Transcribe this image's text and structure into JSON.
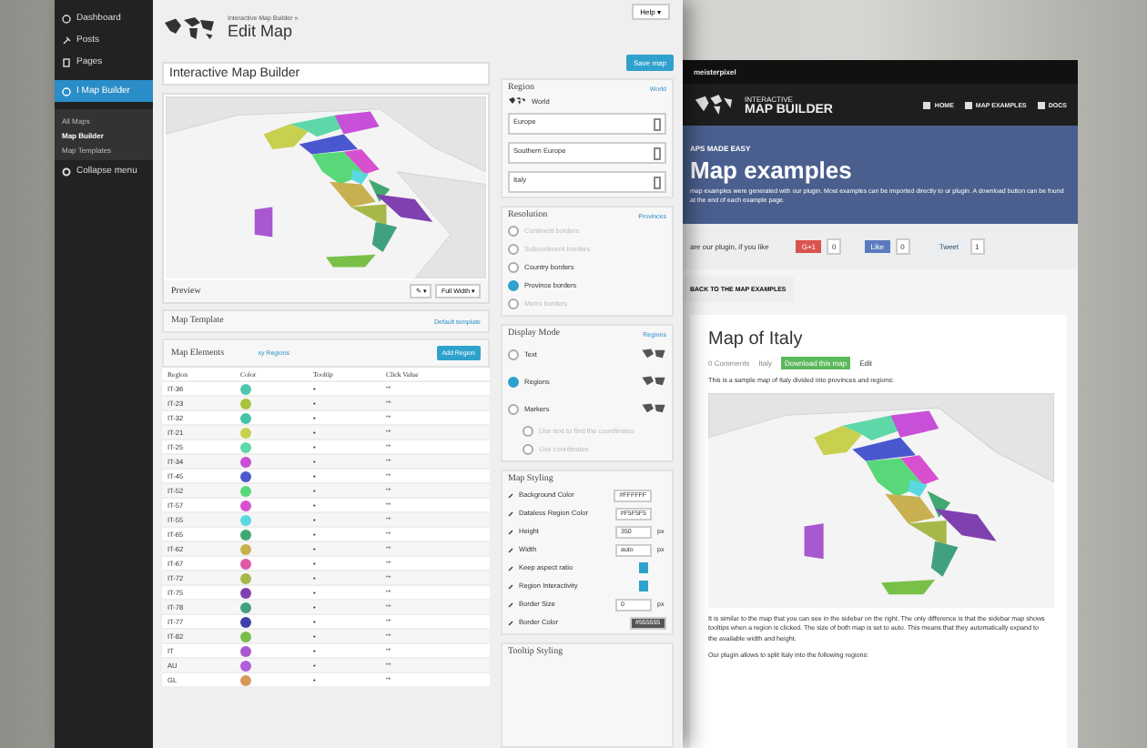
{
  "admin": {
    "sidebar": [
      {
        "label": "Dashboard",
        "selected": false
      },
      {
        "label": "Posts",
        "selected": false
      },
      {
        "label": "Pages",
        "selected": false
      },
      {
        "label": "I Map Builder",
        "selected": true
      }
    ],
    "submenu": [
      {
        "label": "All Maps",
        "selected": false
      },
      {
        "label": "Map Builder",
        "selected": true
      },
      {
        "label": "Map Templates",
        "selected": false
      }
    ],
    "collapse": "Collapse menu",
    "breadcrumb": "Interactive Map Builder »",
    "page_title": "Edit Map",
    "help": "Help ▾",
    "map_title": "Interactive Map Builder",
    "save": "Save map",
    "preview": {
      "label": "Preview",
      "tool": "✎ ▾",
      "size": "Full Width ▾"
    },
    "template": {
      "label": "Map Template",
      "link": "Default template"
    },
    "elements": {
      "label": "Map Elements",
      "link": "xy Regions",
      "button": "Add Region",
      "columns": [
        "Region",
        "Color",
        "Tooltip",
        "Click Value"
      ],
      "rows": [
        {
          "region": "IT-36",
          "color": "#4fc7b0",
          "tooltip": "•",
          "click": "\"\""
        },
        {
          "region": "IT-23",
          "color": "#a8c43c",
          "tooltip": "•",
          "click": "\"\""
        },
        {
          "region": "IT-32",
          "color": "#45c4a8",
          "tooltip": "•",
          "click": "\"\""
        },
        {
          "region": "IT-21",
          "color": "#c8d050",
          "tooltip": "•",
          "click": "\"\""
        },
        {
          "region": "IT-25",
          "color": "#5ed8a8",
          "tooltip": "•",
          "click": "\"\""
        },
        {
          "region": "IT-34",
          "color": "#c850d8",
          "tooltip": "•",
          "click": "\"\""
        },
        {
          "region": "IT-45",
          "color": "#4a58d0",
          "tooltip": "•",
          "click": "\"\""
        },
        {
          "region": "IT-52",
          "color": "#58d878",
          "tooltip": "•",
          "click": "\"\""
        },
        {
          "region": "IT-57",
          "color": "#d850d0",
          "tooltip": "•",
          "click": "\"\""
        },
        {
          "region": "IT-55",
          "color": "#58d8e0",
          "tooltip": "•",
          "click": "\"\""
        },
        {
          "region": "IT-65",
          "color": "#40a870",
          "tooltip": "•",
          "click": "\"\""
        },
        {
          "region": "IT-62",
          "color": "#c8b050",
          "tooltip": "•",
          "click": "\"\""
        },
        {
          "region": "IT-67",
          "color": "#e058a8",
          "tooltip": "•",
          "click": "\"\""
        },
        {
          "region": "IT-72",
          "color": "#a8b848",
          "tooltip": "•",
          "click": "\"\""
        },
        {
          "region": "IT-75",
          "color": "#8040b0",
          "tooltip": "•",
          "click": "\"\""
        },
        {
          "region": "IT-78",
          "color": "#40a080",
          "tooltip": "•",
          "click": "\"\""
        },
        {
          "region": "IT-77",
          "color": "#4040a8",
          "tooltip": "•",
          "click": "\"\""
        },
        {
          "region": "IT-82",
          "color": "#78c048",
          "tooltip": "•",
          "click": "\"\""
        },
        {
          "region": "IT",
          "color": "#a858d0",
          "tooltip": "•",
          "click": "\"\""
        },
        {
          "region": "AU",
          "color": "#b060d8",
          "tooltip": "•",
          "click": "\"\""
        },
        {
          "region": "GL",
          "color": "#d89858",
          "tooltip": "•",
          "click": "\"\""
        }
      ]
    },
    "region": {
      "label": "Region",
      "link": "World",
      "world": "World",
      "selects": [
        "Europe",
        "Southern Europe",
        "Italy"
      ]
    },
    "resolution": {
      "label": "Resolution",
      "link": "Provinces",
      "options": [
        {
          "label": "Continent borders",
          "selected": false,
          "disabled": true
        },
        {
          "label": "Subcontinent borders",
          "selected": false,
          "disabled": true
        },
        {
          "label": "Country borders",
          "selected": false,
          "disabled": false
        },
        {
          "label": "Province borders",
          "selected": true,
          "disabled": false
        },
        {
          "label": "Metro borders",
          "selected": false,
          "disabled": true
        }
      ]
    },
    "display_mode": {
      "label": "Display Mode",
      "link": "Regions",
      "options": [
        {
          "label": "Text",
          "selected": false
        },
        {
          "label": "Regions",
          "selected": true
        },
        {
          "label": "Markers",
          "selected": false
        }
      ],
      "sub_options": [
        {
          "label": "Use text to find the coordinates",
          "selected": false
        },
        {
          "label": "Use coordinates",
          "selected": false
        }
      ]
    },
    "styling": {
      "label": "Map Styling",
      "rows": [
        {
          "kind": "text",
          "label": "Background Color",
          "value": "#FFFFFF"
        },
        {
          "kind": "text",
          "label": "Dataless Region Color",
          "value": "#F5F5F5"
        },
        {
          "kind": "text",
          "label": "Height",
          "value": "350",
          "unit": "px"
        },
        {
          "kind": "text",
          "label": "Width",
          "value": "auto",
          "unit": "px"
        },
        {
          "kind": "check",
          "label": "Keep aspect ratio",
          "checked": true
        },
        {
          "kind": "check",
          "label": "Region Interactivity",
          "checked": true
        },
        {
          "kind": "text",
          "label": "Border Size",
          "value": "0",
          "unit": "px"
        },
        {
          "kind": "swatch",
          "label": "Border Color",
          "value": "#555555"
        }
      ]
    },
    "tooltip_styling": "Tooltip Styling"
  },
  "site": {
    "brand": "meisterpixel",
    "logo_top": "INTERACTIVE",
    "logo_bottom": "MAP BUILDER",
    "nav": [
      {
        "label": "HOME"
      },
      {
        "label": "MAP EXAMPLES"
      },
      {
        "label": "DOCS"
      }
    ],
    "kicker": "APS MADE EASY",
    "title": "Map examples",
    "intro": "map examples were generated with our plugin. Most examples can be imported directly to ur plugin. A download button can be found at the end of each example page.",
    "share_text": "are our plugin, if you like",
    "shares": [
      {
        "label": "G+1",
        "count": "0",
        "color": "#d9534f"
      },
      {
        "label": "Like",
        "count": "0",
        "color": "#5b7bc0"
      },
      {
        "label": "Tweet",
        "count": "1",
        "color": "#e8eef4"
      }
    ],
    "back": "BACK TO THE MAP EXAMPLES",
    "post_title": "Map of Italy",
    "comments": "0 Comments",
    "category": "Italy",
    "download": "Download this map",
    "edit": "Edit",
    "lead": "This is a sample map of Italy divided into provinces and regions:",
    "body": "It is similar to the map that you can see in the sidebar on the right. The only difference is that the sidebar map shows tooltips when a region is clicked. The size of both map is set to auto. This means that they automatically expand to the available width and height.",
    "regions_intro": "Our plugin allows to split Italy into the following regions:"
  }
}
